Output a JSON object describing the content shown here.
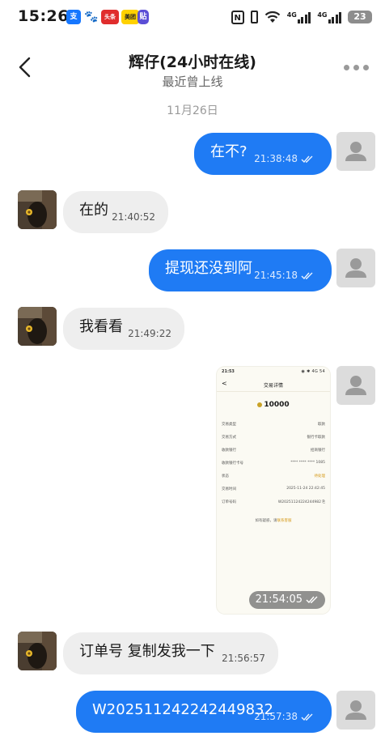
{
  "status_bar": {
    "time": "15:26",
    "icon_zhi": "支",
    "icon_paw": "🐾",
    "icon_red": "头条",
    "icon_meituan": "美团",
    "icon_tie": "贴",
    "nfc": "N",
    "net1": "4G",
    "net2": "4G",
    "battery": "23"
  },
  "header": {
    "title": "辉仔(24小时在线)",
    "subtitle": "最近曾上线"
  },
  "date_label": "11月26日",
  "messages": [
    {
      "text": "在不?",
      "time": "21:38:48"
    },
    {
      "text": "在的",
      "time": "21:40:52"
    },
    {
      "text": "提现还没到阿",
      "time": "21:45:18"
    },
    {
      "text": "我看看",
      "time": "21:49:22"
    },
    {
      "text": "",
      "time": "21:54:05"
    },
    {
      "text": "订单号 复制发我一下",
      "time": "21:56:57"
    },
    {
      "text": "W20251124224244​9832",
      "time": "21:57:38"
    }
  ],
  "screenshot": {
    "status_time": "21:53",
    "status_right": "◉ ✱ 4G 54",
    "back": "<",
    "heading": "交易详情",
    "amount": "10000",
    "rows": [
      {
        "k": "交易类型",
        "v": "取款"
      },
      {
        "k": "交易方式",
        "v": "银行卡取款"
      },
      {
        "k": "收款银行",
        "v": "招商银行"
      },
      {
        "k": "收款银行卡号",
        "v": "**** **** **** 1085"
      },
      {
        "k": "状态",
        "v": "待处理"
      },
      {
        "k": "交易时间",
        "v": "2025-11-24 22:42:45"
      },
      {
        "k": "订单号码",
        "v": "W20251124224244982 ⎘"
      }
    ],
    "footer_text": "如有疑惑，请",
    "footer_link": "联系客服"
  },
  "colors": {
    "my_bubble": "#1f7bf4",
    "other_bubble": "#eeeeee"
  }
}
